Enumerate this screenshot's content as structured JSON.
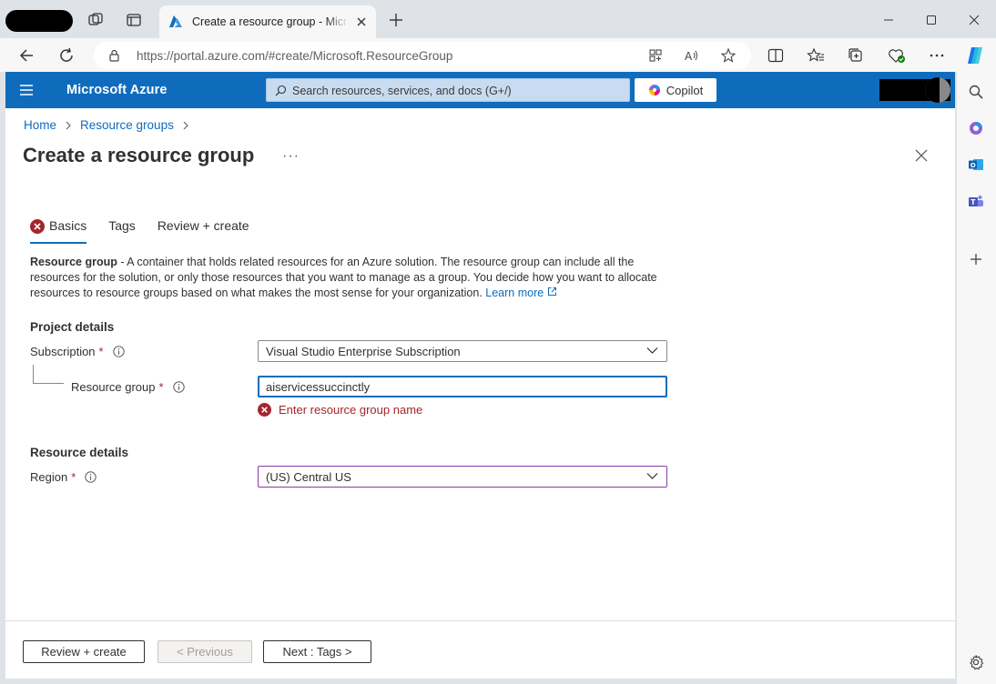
{
  "browser": {
    "tab_title": "Create a resource group - Microsoft Azure",
    "url_host": "https://portal.azure.com",
    "url_path": "/#create/Microsoft.ResourceGroup"
  },
  "portal": {
    "brand": "Microsoft Azure",
    "search_placeholder": "Search resources, services, and docs (G+/)",
    "copilot_label": "Copilot"
  },
  "breadcrumb": [
    {
      "label": "Home"
    },
    {
      "label": "Resource groups"
    }
  ],
  "page": {
    "title": "Create a resource group",
    "more": "···"
  },
  "tabs": [
    {
      "label": "Basics",
      "has_error": true,
      "active": true
    },
    {
      "label": "Tags"
    },
    {
      "label": "Review + create"
    }
  ],
  "description": {
    "term": "Resource group",
    "text": " - A container that holds related resources for an Azure solution. The resource group can include all the resources for the solution, or only those resources that you want to manage as a group. You decide how you want to allocate resources to resource groups based on what makes the most sense for your organization. ",
    "link": "Learn more"
  },
  "project_details": {
    "heading": "Project details",
    "subscription_label": "Subscription",
    "subscription_value": "Visual Studio Enterprise Subscription",
    "resource_group_label": "Resource group",
    "resource_group_value": "aiservicessuccinctly",
    "resource_group_error": "Enter resource group name"
  },
  "resource_details": {
    "heading": "Resource details",
    "region_label": "Region",
    "region_value": "(US) Central US"
  },
  "required_mark": "*",
  "footer": {
    "review_create": "Review + create",
    "previous": "< Previous",
    "next": "Next : Tags >"
  },
  "colors": {
    "azure_blue": "#0f6cbd",
    "error_red": "#a4262c",
    "region_border": "#8a3aa8"
  }
}
